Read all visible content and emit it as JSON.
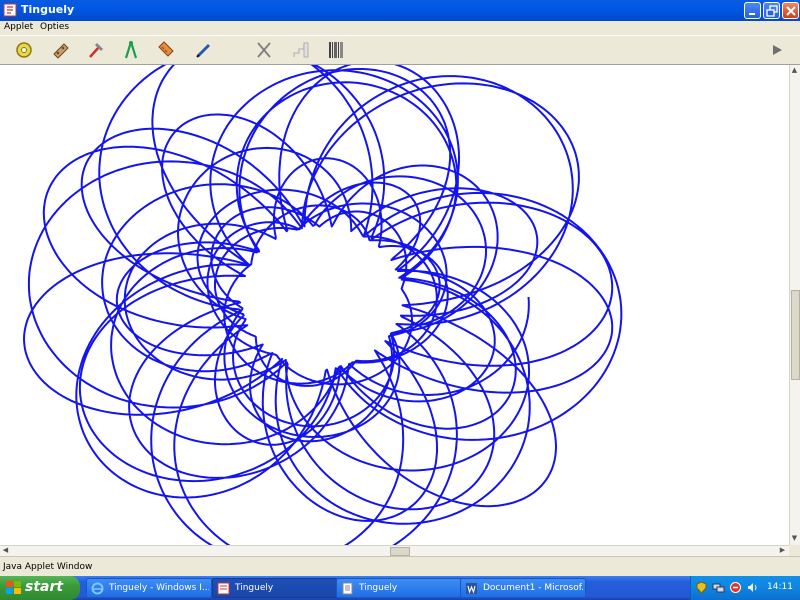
{
  "window": {
    "title": "Tinguely",
    "icon": "java-applet-icon",
    "controls": [
      "minimize-icon",
      "maximize-icon",
      "close-icon"
    ]
  },
  "menubar": {
    "items": [
      "Applet",
      "Opties"
    ]
  },
  "toolbar": {
    "tools": [
      "motor-icon",
      "arm-icon",
      "hammer-icon",
      "compass-icon",
      "ruler-icon",
      "pen-icon",
      "scissors-icon",
      "stairs-icon",
      "barcode-icon"
    ],
    "play_icon": "play-icon"
  },
  "drawing": {
    "stroke_color": "#1414ef",
    "background": "#ffffff"
  },
  "status": {
    "text": "Java Applet Window"
  },
  "taskbar": {
    "start_label": "start",
    "tasks": [
      {
        "label": "Tinguely - Windows I...",
        "icon": "ie-icon",
        "active": false
      },
      {
        "label": "Tinguely",
        "icon": "java-applet-icon",
        "active": true
      },
      {
        "label": "Tinguely",
        "icon": "document-icon",
        "active": false
      },
      {
        "label": "Document1 - Microsof...",
        "icon": "word-icon",
        "active": false
      }
    ],
    "tray_icons": [
      "shield-icon",
      "network-icon",
      "antivirus-icon",
      "speaker-icon"
    ],
    "clock": "14:11"
  },
  "colors": {
    "titlebar": "#0058e6",
    "taskbar": "#245edb",
    "start": "#3c9a3c",
    "tray": "#0f85e0"
  }
}
